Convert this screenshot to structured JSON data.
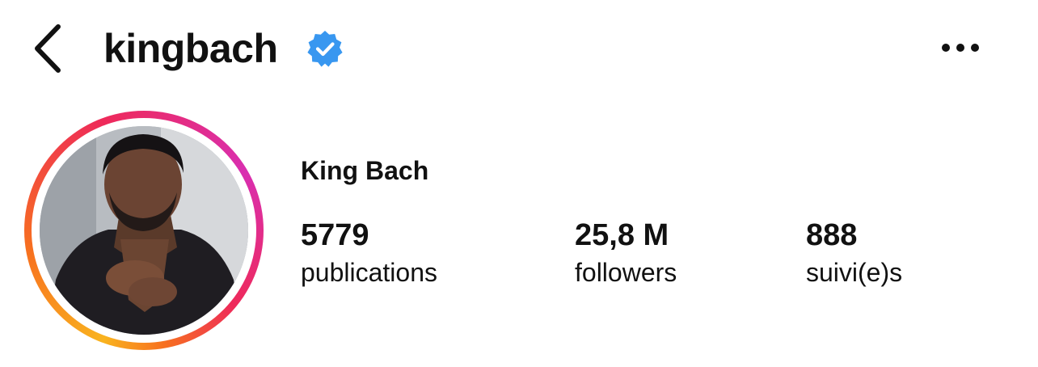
{
  "header": {
    "back_icon": "chevron-left-icon",
    "username": "kingbach",
    "verified_icon": "verified-badge-icon",
    "more_icon": "more-horizontal-icon"
  },
  "profile": {
    "display_name": "King Bach",
    "stats": [
      {
        "value": "5779",
        "label": "publications"
      },
      {
        "value": "25,8 M",
        "label": "followers"
      },
      {
        "value": "888",
        "label": "suivi(e)s"
      }
    ]
  },
  "colors": {
    "verified_blue": "#3897f0",
    "story_ring": [
      "#f9b31f",
      "#f7701f",
      "#ee2a5a",
      "#d92fb0"
    ],
    "text": "#111111"
  }
}
